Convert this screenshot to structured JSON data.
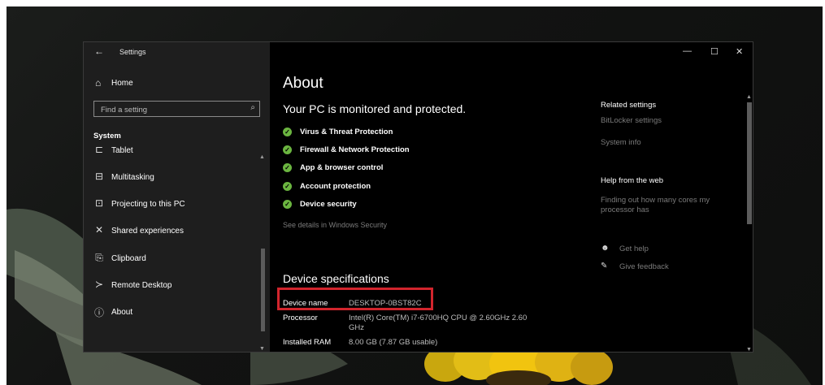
{
  "window": {
    "back_glyph": "←",
    "app_title": "Settings",
    "minimize_glyph": "—",
    "maximize_glyph": "☐",
    "close_glyph": "✕"
  },
  "sidebar": {
    "home": {
      "icon": "home-icon",
      "glyph": "⌂",
      "label": "Home"
    },
    "search": {
      "placeholder": "Find a setting",
      "value": "",
      "icon": "search-icon",
      "glyph": "⌕"
    },
    "section_title": "System",
    "items": [
      {
        "name": "tablet",
        "icon": "tablet-icon",
        "glyph": "⊏",
        "label": "Tablet"
      },
      {
        "name": "multitasking",
        "icon": "multitasking-icon",
        "glyph": "⊟",
        "label": "Multitasking"
      },
      {
        "name": "projecting",
        "icon": "projector-icon",
        "glyph": "⊡",
        "label": "Projecting to this PC"
      },
      {
        "name": "shared-experiences",
        "icon": "shared-experiences-icon",
        "glyph": "✕",
        "label": "Shared experiences"
      },
      {
        "name": "clipboard",
        "icon": "clipboard-icon",
        "glyph": "⎘",
        "label": "Clipboard"
      },
      {
        "name": "remote-desktop",
        "icon": "remote-desktop-icon",
        "glyph": "≻",
        "label": "Remote Desktop"
      },
      {
        "name": "about",
        "icon": "info-icon",
        "glyph": "ⓘ",
        "label": "About"
      }
    ],
    "scroll_up": "▲",
    "scroll_down": "▼"
  },
  "main": {
    "title": "About",
    "protection_heading": "Your PC is monitored and protected.",
    "protection_items": [
      "Virus & Threat Protection",
      "Firewall & Network Protection",
      "App & browser control",
      "Account protection",
      "Device security"
    ],
    "check_glyph": "✓",
    "see_details": "See details in Windows Security",
    "specs_heading": "Device specifications",
    "specs": [
      {
        "label": "Device name",
        "value": "DESKTOP-0BST82C"
      },
      {
        "label": "Processor",
        "value": "Intel(R) Core(TM) i7-6700HQ CPU @ 2.60GHz 2.60 GHz"
      },
      {
        "label": "Installed RAM",
        "value": "8.00 GB (7.87 GB usable)"
      }
    ],
    "related": {
      "heading": "Related settings",
      "links": [
        "BitLocker settings",
        "System info"
      ],
      "help_heading": "Help from the web",
      "help_link": "Finding out how many cores my processor has",
      "get_help": {
        "icon": "chat-help-icon",
        "glyph": "☻",
        "label": "Get help"
      },
      "give_feedback": {
        "icon": "feedback-icon",
        "glyph": "✎",
        "label": "Give feedback"
      }
    }
  },
  "colors": {
    "check_green": "#6bb540",
    "highlight_red": "#d2252d",
    "sidebar_bg": "#1e1e1e",
    "content_bg": "#000000"
  }
}
